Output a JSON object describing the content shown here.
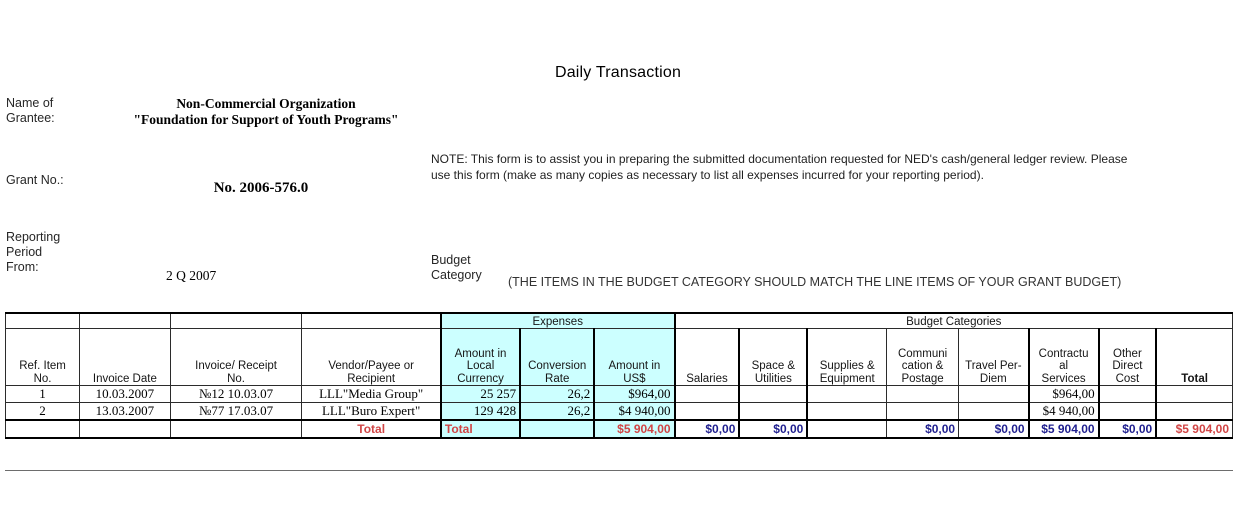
{
  "document": {
    "title": "Daily Transaction"
  },
  "header": {
    "grantee": {
      "label": "Name of\nGrantee:",
      "line1": "Non-Commercial Organization",
      "line2": "\"Foundation for Support of Youth Programs\""
    },
    "grant_no": {
      "label": "Grant No.:",
      "value": "No. 2006-576.0"
    },
    "reporting_period": {
      "label": "Reporting\nPeriod\nFrom:",
      "value": "2 Q 2007"
    },
    "note": "NOTE:  This form is to assist you in preparing the submitted documentation requested for NED's cash/general ledger review.  Please use this form (make as many copies as necessary to list all expenses incurred for your reporting period).",
    "budget_category": {
      "label": "Budget\nCategory",
      "note": "(THE ITEMS IN THE BUDGET CATEGORY SHOULD MATCH THE LINE ITEMS OF YOUR GRANT BUDGET)"
    }
  },
  "table": {
    "group_headers": {
      "expenses": "Expenses",
      "budget_categories": "Budget Categories"
    },
    "columns": [
      "Ref. Item\nNo.",
      "Invoice Date",
      "Invoice/ Receipt\nNo.",
      "Vendor/Payee or\nRecipient",
      "Amount in\nLocal\nCurrency",
      "Conversion\nRate",
      "Amount in\nUS$",
      "Salaries",
      "Space &\nUtilities",
      "Supplies &\nEquipment",
      "Communi\ncation &\nPostage",
      "Travel Per-\nDiem",
      "Contractu\nal\nServices",
      "Other\nDirect\nCost",
      "Total"
    ],
    "rows": [
      {
        "ref_no": "1",
        "invoice_date": "10.03.2007",
        "invoice_receipt_no": "№12  10.03.07",
        "vendor": "LLL\"Media Group\"",
        "amount_local": "25 257",
        "conversion_rate": "26,2",
        "amount_usd": "$964,00",
        "salaries": "",
        "space_utilities": "",
        "supplies_equipment": "",
        "communication_postage": "",
        "travel_per_diem": "",
        "contractual_services": "$964,00",
        "other_direct_cost": "",
        "total": ""
      },
      {
        "ref_no": "2",
        "invoice_date": "13.03.2007",
        "invoice_receipt_no": "№77 17.03.07",
        "vendor": "LLL\"Buro Expert\"",
        "amount_local": "129 428",
        "conversion_rate": "26,2",
        "amount_usd": "$4 940,00",
        "salaries": "",
        "space_utilities": "",
        "supplies_equipment": "",
        "communication_postage": "",
        "travel_per_diem": "",
        "contractual_services": "$4 940,00",
        "other_direct_cost": "",
        "total": ""
      }
    ],
    "totals_row": {
      "ref_no": "",
      "invoice_date": "",
      "invoice_receipt_no": "",
      "vendor_label": "Total",
      "amount_local_label": "Total",
      "conversion_rate": "",
      "amount_usd": "$5 904,00",
      "salaries": "$0,00",
      "space_utilities": "$0,00",
      "supplies_equipment": "",
      "communication_postage": "$0,00",
      "travel_per_diem": "$0,00",
      "contractual_services": "$5 904,00",
      "other_direct_cost": "$0,00",
      "total": "$5 904,00"
    }
  },
  "colors": {
    "expense_fill": "#ccffff",
    "total_red": "#d14545",
    "total_blue": "#1f1f8f",
    "grid": "#2b2b2b"
  }
}
